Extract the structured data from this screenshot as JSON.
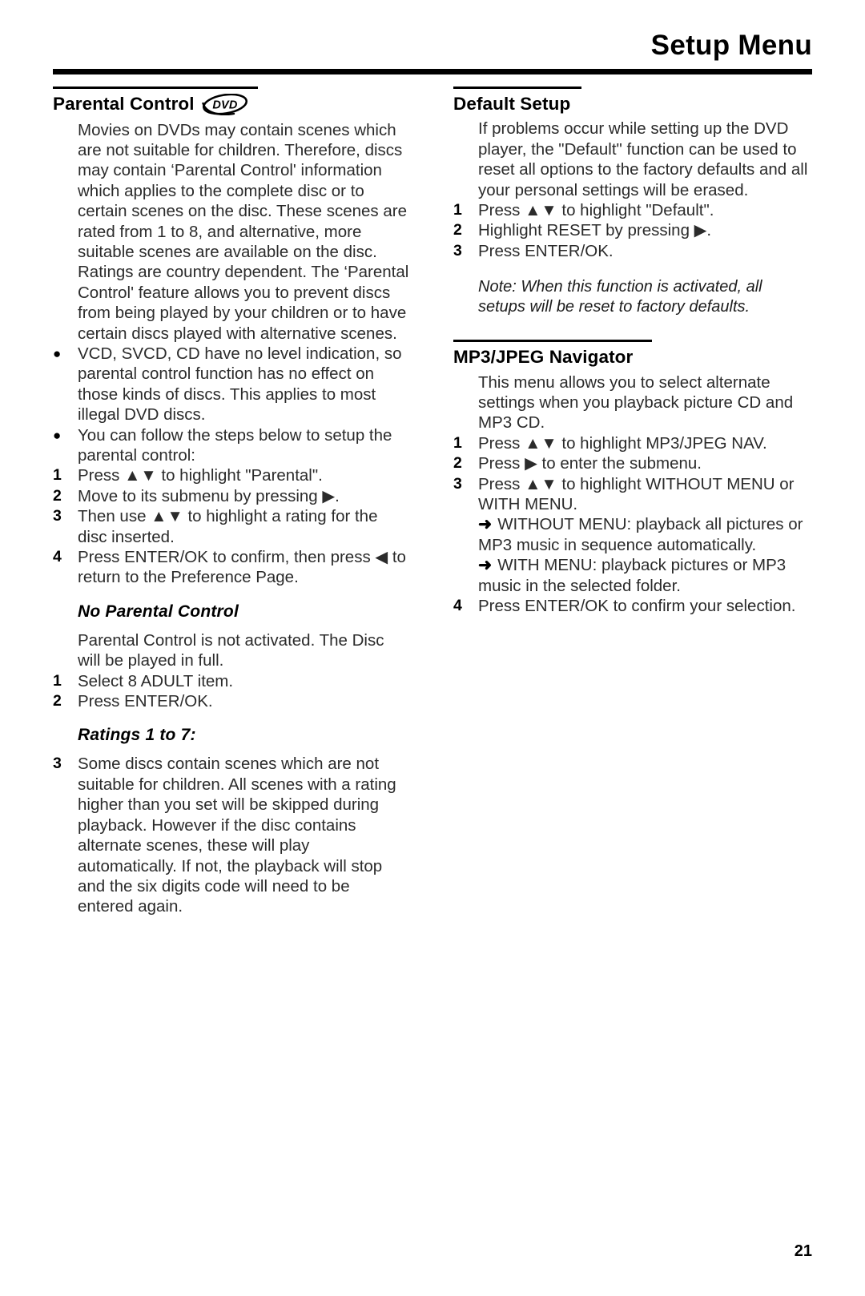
{
  "header": {
    "title": "Setup Menu"
  },
  "footer": {
    "page_number": "21"
  },
  "left_column": {
    "section_title": "Parental Control",
    "disc_badge": "DVD",
    "intro": "Movies on DVDs may contain scenes which are not suitable for children. Therefore, discs may contain ‘Parental Control' information which applies to the complete disc or to certain scenes on the disc. These scenes are rated from 1 to 8, and alternative, more suitable scenes are available on the disc. Ratings are country dependent. The ‘Parental Control' feature allows you to prevent discs from being played by your children or to have certain discs played with alternative scenes.",
    "bullets": [
      {
        "marker": "●",
        "text": "VCD, SVCD, CD have no level indication, so parental control function has no effect on those kinds of discs. This applies to most illegal DVD discs."
      },
      {
        "marker": "●",
        "text": "You can follow the steps below to setup the parental control:"
      }
    ],
    "steps": [
      {
        "marker": "1",
        "text": "Press ▲▼ to highlight \"Parental\"."
      },
      {
        "marker": "2",
        "text": "Move to its submenu by pressing ▶."
      },
      {
        "marker": "3",
        "text": "Then use ▲▼ to highlight a rating for the disc inserted."
      },
      {
        "marker": "4",
        "text": "Press ENTER/OK to confirm, then press ◀ to return to the Preference Page."
      }
    ],
    "no_parental": {
      "subhead": "No Parental Control",
      "text": "Parental Control is not activated. The Disc will be played in full.",
      "steps": [
        {
          "marker": "1",
          "text": "Select 8 ADULT item."
        },
        {
          "marker": "2",
          "text": "Press ENTER/OK."
        }
      ]
    },
    "ratings": {
      "subhead": "Ratings 1 to 7:",
      "steps": [
        {
          "marker": "3",
          "text": "Some discs contain scenes which are not suitable for children. All scenes with a rating higher than you set will be skipped during playback. However if the disc contains alternate scenes, these will play automatically. If not, the playback will stop and the six digits code will need to be entered again."
        }
      ]
    }
  },
  "right_column": {
    "default_setup": {
      "section_title": "Default Setup",
      "intro": "If problems occur while setting up the DVD player, the \"Default\" function can be used to reset all options to the factory defaults and all your personal settings will be erased.",
      "steps": [
        {
          "marker": "1",
          "text": "Press ▲▼ to highlight \"Default\"."
        },
        {
          "marker": "2",
          "text": "Highlight RESET by pressing ▶."
        },
        {
          "marker": "3",
          "text": "Press ENTER/OK."
        }
      ],
      "note": "Note: When this function is activated, all setups will be reset to factory defaults."
    },
    "mp3_navigator": {
      "section_title": "MP3/JPEG Navigator",
      "intro": "This menu allows you to select alternate settings when you playback picture CD and MP3 CD.",
      "steps": [
        {
          "marker": "1",
          "text": "Press ▲▼ to highlight MP3/JPEG NAV."
        },
        {
          "marker": "2",
          "text": "Press ▶ to enter the submenu."
        },
        {
          "marker": "3",
          "text": "Press ▲▼ to highlight WITHOUT MENU or WITH MENU."
        }
      ],
      "arrows": [
        {
          "marker": "➜",
          "text": "WITHOUT MENU: playback all pictures or MP3 music in sequence automatically."
        },
        {
          "marker": "➜",
          "text": "WITH MENU: playback pictures or MP3 music in the selected folder."
        }
      ],
      "final_step": {
        "marker": "4",
        "text": "Press ENTER/OK to confirm your selection."
      }
    }
  }
}
